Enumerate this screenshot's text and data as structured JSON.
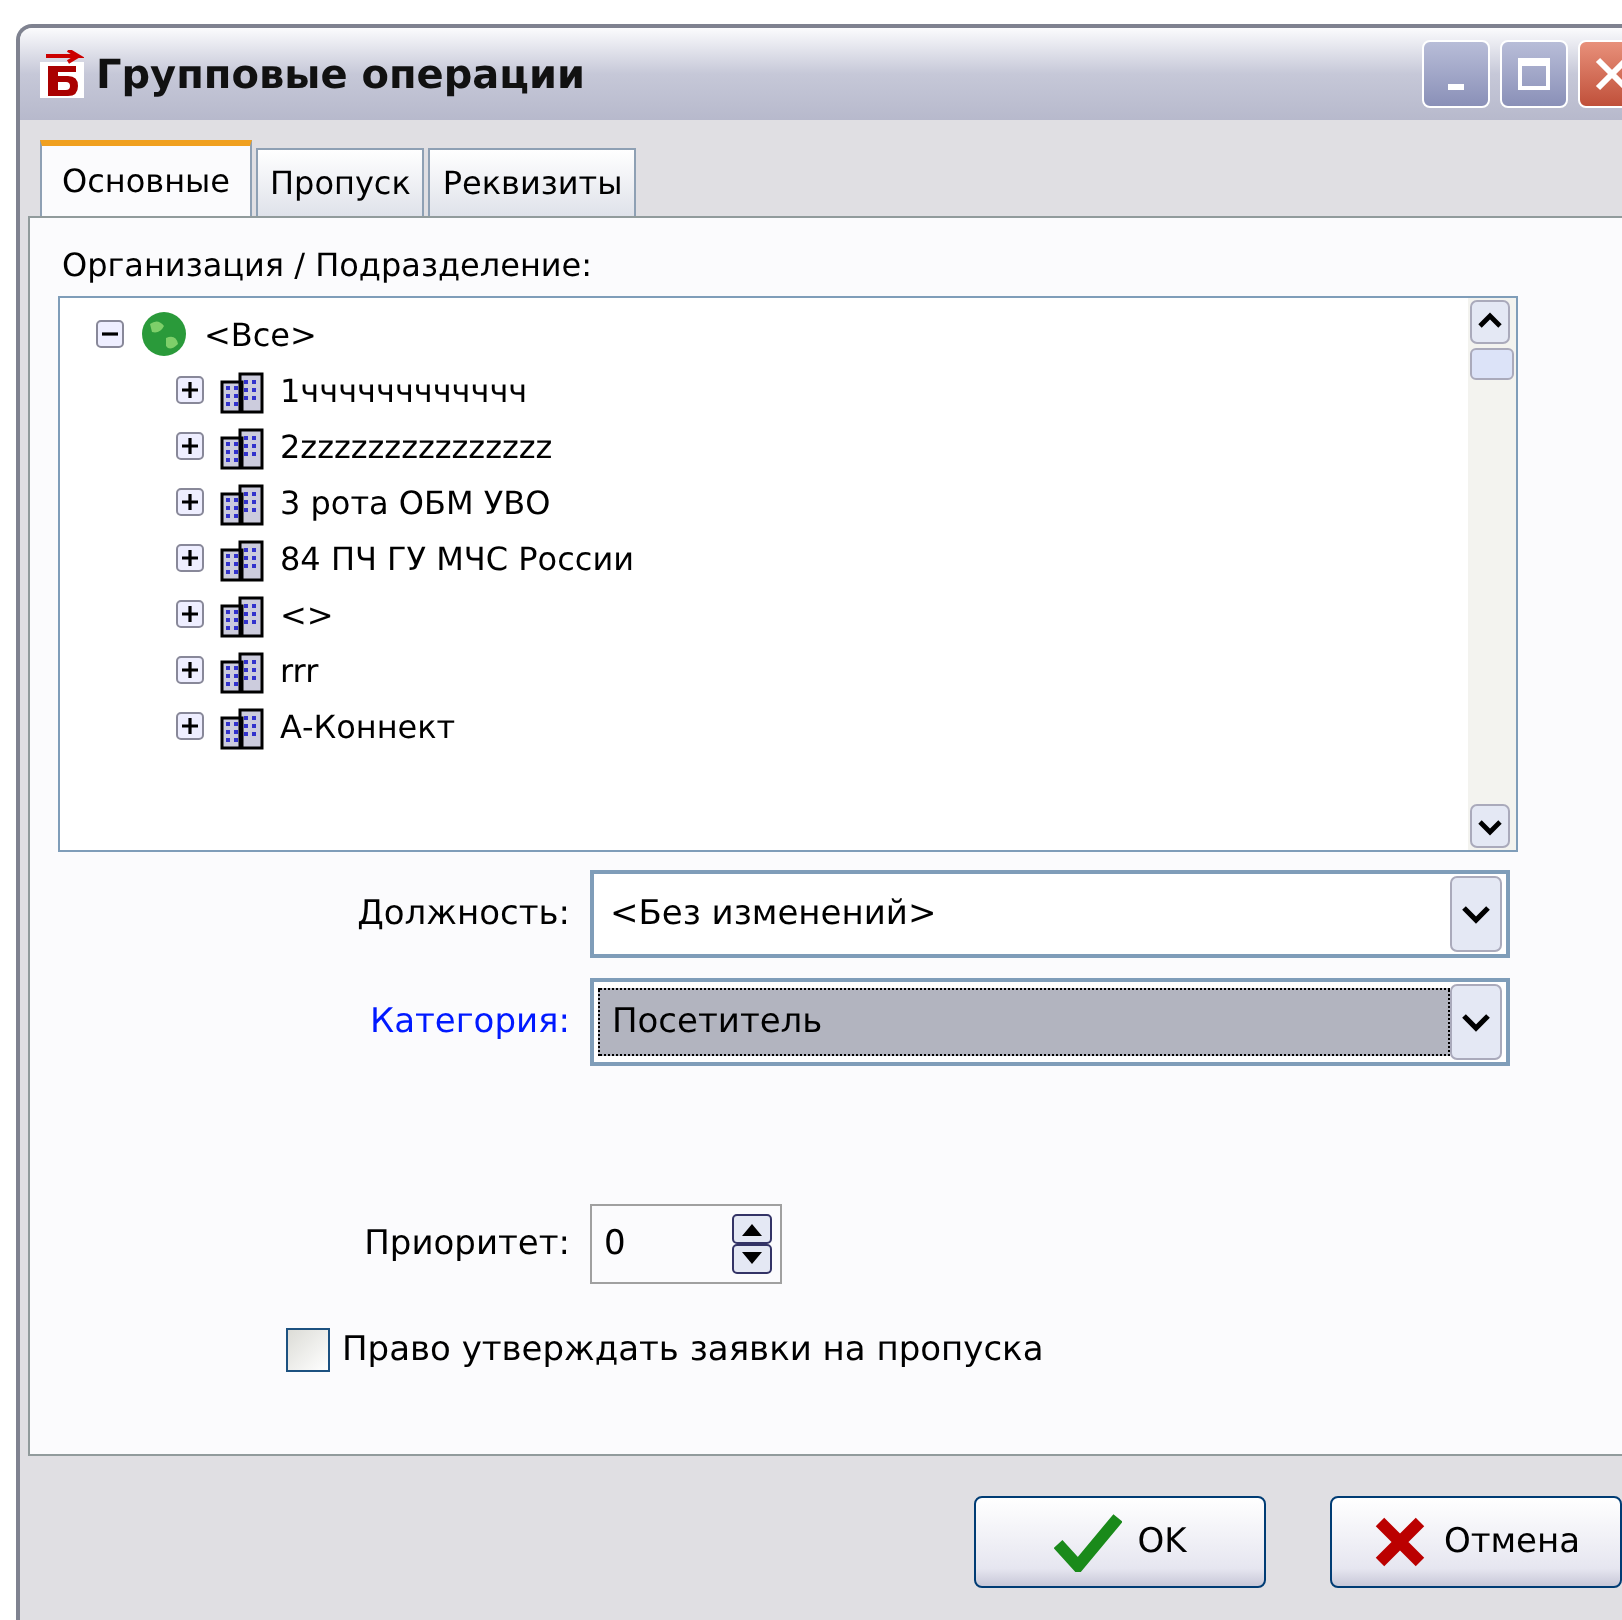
{
  "window": {
    "title": "Групповые операции"
  },
  "tabs": [
    {
      "label": "Основные",
      "selected": true
    },
    {
      "label": "Пропуск",
      "selected": false
    },
    {
      "label": "Реквизиты",
      "selected": false
    }
  ],
  "org_label": "Организация / Подразделение:",
  "tree": [
    {
      "label": "<Все>",
      "kind": "globe",
      "expanded": true,
      "children": [
        {
          "label": "1чччччччччччч",
          "kind": "building",
          "expanded": false
        },
        {
          "label": "2zzzzzzzzzzzzzzz",
          "kind": "building",
          "expanded": false
        },
        {
          "label": "3 рота ОБМ УВО",
          "kind": "building",
          "expanded": false
        },
        {
          "label": "84 ПЧ ГУ МЧС России",
          "kind": "building",
          "expanded": false
        },
        {
          "label": "<>",
          "kind": "building",
          "expanded": false
        },
        {
          "label": "rrr",
          "kind": "building",
          "expanded": false
        },
        {
          "label": "А-Коннект",
          "kind": "building",
          "expanded": false
        }
      ]
    }
  ],
  "fields": [
    {
      "label": "Должность:",
      "value": "<Без изменений>",
      "focused": false
    },
    {
      "label": "Категория:",
      "value": "Посетитель",
      "focused": true
    }
  ],
  "priority": {
    "label": "Приоритет:",
    "value": "0"
  },
  "approve": {
    "label": "Право утверждать заявки на пропуска",
    "checked": false
  },
  "buttons": [
    {
      "label": "OK",
      "kind": "ok"
    },
    {
      "label": "Отмена",
      "kind": "cancel"
    }
  ]
}
